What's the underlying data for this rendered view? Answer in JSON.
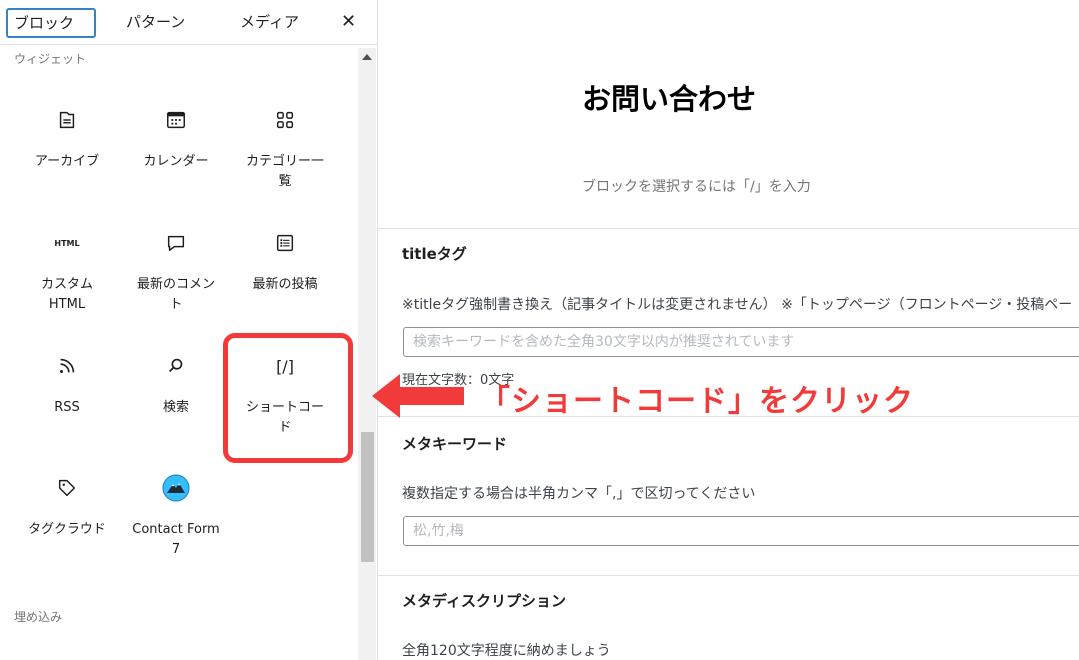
{
  "sidebar": {
    "tabs": [
      "ブロック",
      "パターン",
      "メディア"
    ],
    "close_label": "✕",
    "section_widgets": "ウィジェット",
    "section_embeds": "埋め込み",
    "blocks": [
      {
        "label": "アーカイブ",
        "icon": "archive-icon"
      },
      {
        "label": "カレンダー",
        "icon": "calendar-icon"
      },
      {
        "label": "カテゴリー一\n覧",
        "icon": "categories-grid-icon"
      },
      {
        "label": "カスタム\nHTML",
        "icon": "html-icon",
        "icon_text": "HTML"
      },
      {
        "label": "最新のコメン\nト",
        "icon": "comment-icon"
      },
      {
        "label": "最新の投稿",
        "icon": "list-icon"
      },
      {
        "label": "RSS",
        "icon": "rss-icon"
      },
      {
        "label": "検索",
        "icon": "search-icon"
      },
      {
        "label": "ショートコー\nド",
        "icon": "shortcode-icon",
        "icon_text": "[/]"
      },
      {
        "label": "タグクラウド",
        "icon": "tag-icon"
      },
      {
        "label": "Contact Form\n7",
        "icon": "contact-form-7-icon"
      }
    ]
  },
  "editor": {
    "title": "お問い合わせ",
    "block_placeholder": "ブロックを選択するには「/」を入力"
  },
  "meta": {
    "title_tag": {
      "heading": "titleタグ",
      "description": "※titleタグ強制書き換え（記事タイトルは変更されません） ※「トップページ（フロントページ・投稿ペー",
      "placeholder": "検索キーワードを含めた全角30文字以内が推奨されています",
      "char_count": "現在文字数：0文字"
    },
    "keywords": {
      "heading": "メタキーワード",
      "description": "複数指定する場合は半角カンマ「,」で区切ってください",
      "placeholder": "松,竹,梅"
    },
    "description": {
      "heading": "メタディスクリプション",
      "description": "全角120文字程度に納めましょう"
    }
  },
  "annotation": {
    "callout_text": "「ショートコード」をクリック",
    "color": "#f23a3a"
  }
}
